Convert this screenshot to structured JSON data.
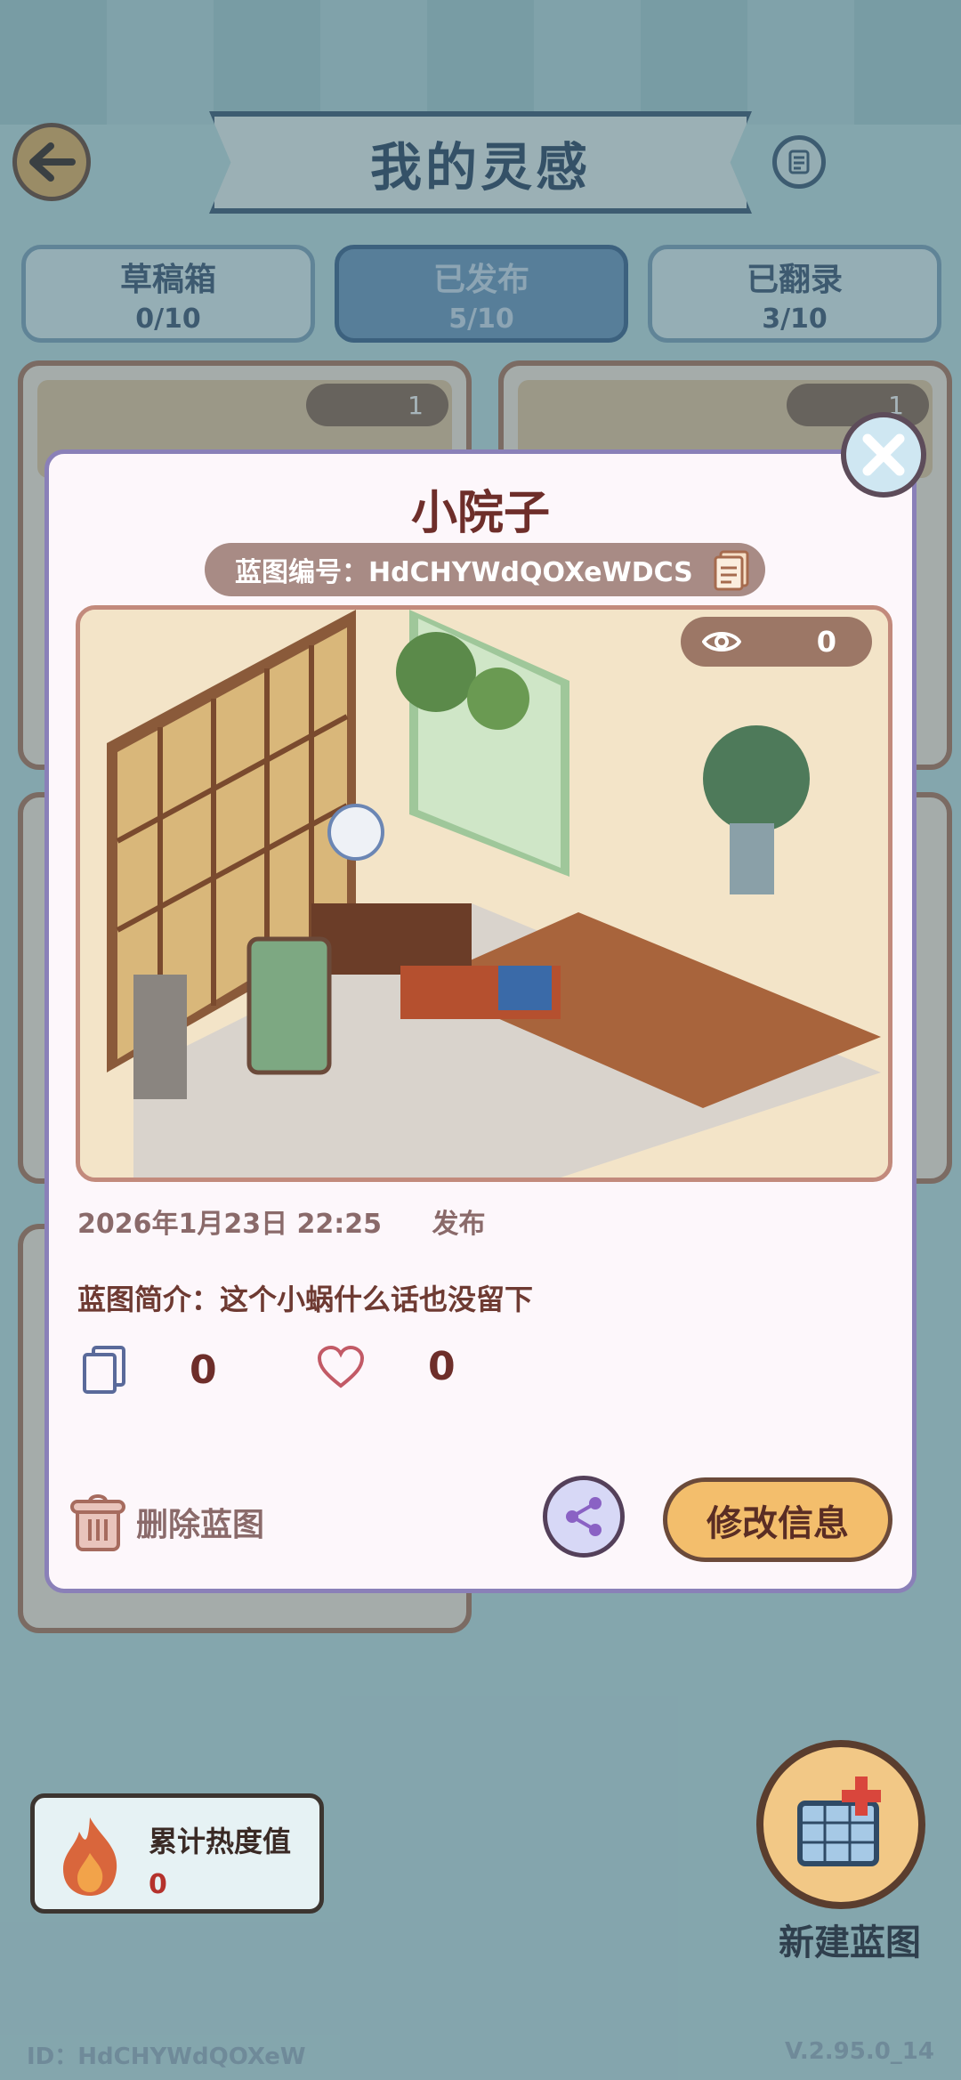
{
  "header": {
    "title": "我的灵感"
  },
  "tabs": [
    {
      "label": "草稿箱",
      "count": "0/10"
    },
    {
      "label": "已发布",
      "count": "5/10"
    },
    {
      "label": "已翻录",
      "count": "3/10"
    }
  ],
  "background_cards": [
    {
      "views": "1"
    },
    {
      "views": "1"
    }
  ],
  "heat": {
    "label": "累计热度值",
    "value": "0"
  },
  "new_blueprint": {
    "label": "新建蓝图"
  },
  "footer": {
    "id": "ID：HdCHYWdQOXeW",
    "version": "V.2.95.0_14"
  },
  "modal": {
    "title": "小院子",
    "code_label": "蓝图编号：HdCHYWdQOXeWDCS",
    "preview_views": "0",
    "date": "2026年1月23日 22:25",
    "published": "发布",
    "description": "蓝图简介：这个小蜗什么话也没留下",
    "copies": "0",
    "likes": "0",
    "delete_label": "删除蓝图",
    "edit_label": "修改信息"
  },
  "colors": {
    "accent": "#f3be6c",
    "title_brown": "#6e2e2a",
    "banner_blue": "#3f5d79",
    "heat_red": "#b5322c"
  }
}
